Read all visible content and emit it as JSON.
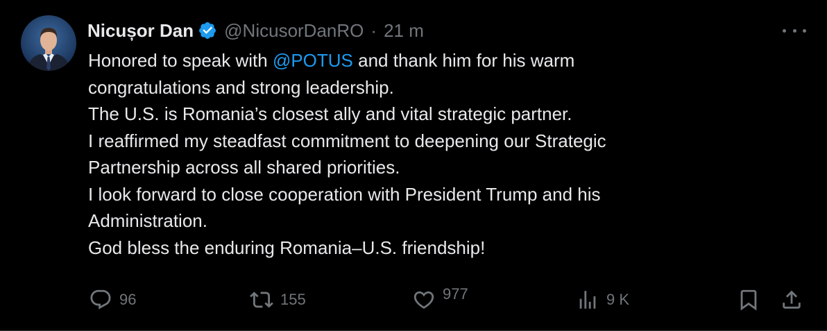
{
  "tweet": {
    "author": {
      "name": "Nicușor Dan",
      "handle": "@NicusorDanRO",
      "verified": true
    },
    "separator": "·",
    "time": "21 m",
    "text": {
      "line1_before": "Honored to speak with ",
      "mention": "@POTUS",
      "line1_after": " and thank him for his warm",
      "line2": "congratulations and strong leadership.",
      "line3": "The U.S. is Romania’s closest ally and vital strategic partner.",
      "line4": "I reaffirmed my steadfast commitment to deepening our Strategic",
      "line5": "Partnership across all shared priorities.",
      "line6": "I look forward to close cooperation with President Trump and his",
      "line7": "Administration.",
      "line8": "God bless the enduring Romania–U.S. friendship!"
    },
    "actions": {
      "replies": "96",
      "reposts": "155",
      "likes": "977",
      "views": "9 K"
    },
    "icons": {
      "verified": "verified-badge-icon",
      "more": "more-icon",
      "reply": "reply-icon",
      "repost": "repost-icon",
      "like": "heart-icon",
      "views": "views-icon",
      "bookmark": "bookmark-icon",
      "share": "share-icon"
    },
    "colors": {
      "background": "#000000",
      "text": "#e7e9ea",
      "muted": "#71767b",
      "accent": "#1d9bf0"
    }
  }
}
